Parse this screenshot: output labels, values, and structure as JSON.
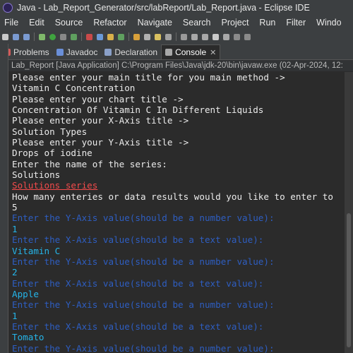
{
  "window": {
    "title": "Java - Lab_Report_Generator/src/labReport/Lab_Report.java - Eclipse IDE"
  },
  "menu": [
    "File",
    "Edit",
    "Source",
    "Refactor",
    "Navigate",
    "Search",
    "Project",
    "Run",
    "Filter",
    "Windo"
  ],
  "tabs": [
    {
      "label": "Problems",
      "icon": "problems-icon",
      "color": "#d45a5a",
      "active": false
    },
    {
      "label": "Javadoc",
      "icon": "javadoc-icon",
      "color": "#6a8fd8",
      "active": false
    },
    {
      "label": "Declaration",
      "icon": "declaration-icon",
      "color": "#8aa0c8",
      "active": false
    },
    {
      "label": "Console",
      "icon": "console-icon",
      "color": "#a8a8a8",
      "active": true
    }
  ],
  "console": {
    "status": "Lab_Report [Java Application] C:\\Program Files\\Java\\jdk-20\\bin\\javaw.exe  (02-Apr-2024, 12:",
    "lines": [
      {
        "text": "Please enter your main title for you main method ->",
        "kind": "out"
      },
      {
        "text": "Vitamin C Concentration",
        "kind": "out"
      },
      {
        "text": "Please enter your chart title ->",
        "kind": "out"
      },
      {
        "text": "Concentration Of Vitamin C In Different Liquids",
        "kind": "out"
      },
      {
        "text": "Please enter your X-Axis title ->",
        "kind": "out"
      },
      {
        "text": "Solution Types",
        "kind": "out"
      },
      {
        "text": "Please enter your Y-Axis title ->",
        "kind": "out"
      },
      {
        "text": "Drops of iodine",
        "kind": "out"
      },
      {
        "text": "Enter the name of the series:",
        "kind": "out"
      },
      {
        "text": "Solutions",
        "kind": "out"
      },
      {
        "text": "Solutions series",
        "kind": "err"
      },
      {
        "text": "How many enteries or data results would you like to enter to",
        "kind": "out"
      },
      {
        "text": "5",
        "kind": "out"
      },
      {
        "text": "Enter the Y-Axis value(should be a number value):",
        "kind": "prompt"
      },
      {
        "text": "1",
        "kind": "inp"
      },
      {
        "text": "Enter the X-Axis value(should be a text value):",
        "kind": "prompt"
      },
      {
        "text": "Vitamin C",
        "kind": "inp"
      },
      {
        "text": "Enter the Y-Axis value(should be a number value):",
        "kind": "prompt"
      },
      {
        "text": "2",
        "kind": "inp"
      },
      {
        "text": "Enter the X-Axis value(should be a text value):",
        "kind": "prompt"
      },
      {
        "text": "Apple",
        "kind": "inp"
      },
      {
        "text": "Enter the Y-Axis value(should be a number value):",
        "kind": "prompt"
      },
      {
        "text": "1",
        "kind": "inp"
      },
      {
        "text": "Enter the X-Axis value(should be a text value):",
        "kind": "prompt"
      },
      {
        "text": "Tomato",
        "kind": "inp"
      },
      {
        "text": "Enter the Y-Axis value(should be a number value):",
        "kind": "prompt"
      }
    ]
  }
}
